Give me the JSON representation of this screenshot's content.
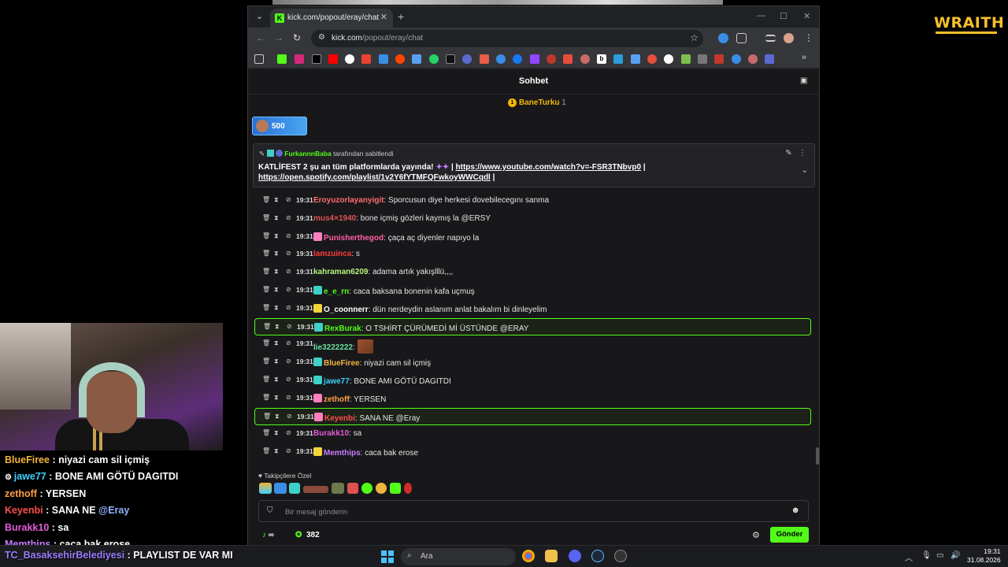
{
  "overlay": {
    "brand": "WRAITH",
    "chat": [
      {
        "user": "BlueFiree",
        "text": " : niyazi cam sil içmiş",
        "color": "#f0b53c",
        "badge": false
      },
      {
        "user": "jawe77",
        "text": " : BONE AMI GÖTÜ DAGITDI",
        "color": "#3fd0ff",
        "badge": true
      },
      {
        "user": "zethoff",
        "text": " : YERSEN",
        "color": "#ff9f43",
        "badge": false
      },
      {
        "user": "Keyenbi",
        "text": " : SANA NE ",
        "mention": "@Eray",
        "color": "#ff4d4d",
        "badge": false
      },
      {
        "user": "Burakk10",
        "text": " : sa",
        "color": "#e35bd9",
        "badge": false
      },
      {
        "user": "Memthips",
        "text": " : caca bak erose",
        "color": "#c87dff",
        "badge": false
      },
      {
        "user": "TC_BasaksehirBelediyesi",
        "text": " : PLAYLIST DE VAR MI",
        "color": "#9b7dff",
        "badge": false
      }
    ]
  },
  "browser": {
    "tab_title": "kick.com/popout/eray/chat",
    "url_domain": "kick.com",
    "url_path": "/popout/eray/chat"
  },
  "chat": {
    "title": "Sohbet",
    "gifter": "BaneTurku",
    "gifter_count": "1",
    "kicks_value": "500",
    "pinned_by_user": "FurkannnBaba",
    "pinned_by_suffix": " tarafından sabitlendi",
    "pinned_text": "KATLİFEST 2 şu an tüm platformlarda yayında! ",
    "pinned_link1": "https://www.youtube.com/watch?v=-FSR3TNbvp0",
    "pinned_link2": "https://open.spotify.com/playlist/1v2Y6fYTMFQFwkoyWWCqdl",
    "pinned_sep": " | ",
    "messages": [
      {
        "time": "19:31",
        "user": "Eroyuzorlayanyigit",
        "color": "#ff6b6b",
        "text": "Sporcusun diye herkesi dovebilecegını sanma",
        "badge": "",
        "hl": false
      },
      {
        "time": "19:31",
        "user": "mus4×1940",
        "color": "#e05252",
        "text": "bone içmiş gözleri kaymış la @ERSY",
        "badge": "",
        "hl": false
      },
      {
        "time": "19:31",
        "user": "Punisherthegod",
        "color": "#ff5fa2",
        "text": "çaça aç diyenler napıyo la",
        "badge": "3m",
        "badgeColor": "#ff7fbf",
        "hl": false
      },
      {
        "time": "19:31",
        "user": "Iamzuinca",
        "color": "#ff3b3b",
        "text": "s",
        "badge": "",
        "hl": false
      },
      {
        "time": "19:31",
        "user": "kahraman6209",
        "color": "#b7f37a",
        "text": "adama artık yakışlllü,,,,",
        "badge": "",
        "hl": false
      },
      {
        "time": "19:31",
        "user": "e_e_rn",
        "color": "#53fc18",
        "text": "caca baksana bonenin kafa uçmuş",
        "badge": "12",
        "badgeColor": "#3fd0c8",
        "hl": false
      },
      {
        "time": "19:31",
        "user": "O_coonnerr",
        "color": "#ffffff",
        "text": "dün nerdeydin aslanım anlat bakalım bi dinleyelim",
        "badge": "18",
        "badgeColor": "#f2d43a",
        "hl": false
      },
      {
        "time": "19:31",
        "user": "RexBurak",
        "color": "#53fc18",
        "text": "O TSHİRT ÇÜRÜMEDİ Mİ ÜSTÜNDE @ERAY",
        "badge": "36",
        "badgeColor": "#3fd0c8",
        "hl": true
      },
      {
        "time": "19:31",
        "user": "lie3222222",
        "color": "#6be0a0",
        "text": "",
        "badge": "",
        "hl": false,
        "emote": true
      },
      {
        "time": "19:31",
        "user": "BlueFiree",
        "color": "#f0b53c",
        "text": "niyazi cam sil içmiş",
        "badge": "36",
        "badgeColor": "#3fd0c8",
        "hl": false
      },
      {
        "time": "19:31",
        "user": "jawe77",
        "color": "#3fd0ff",
        "text": "BONE AMI GÖTÜ DAGITDI",
        "badge": "24",
        "badgeColor": "#3fd0c8",
        "hl": false
      },
      {
        "time": "19:31",
        "user": "zethoff",
        "color": "#ff9f43",
        "text": "YERSEN",
        "badge": "3m",
        "badgeColor": "#ff7fbf",
        "hl": false
      },
      {
        "time": "19:31",
        "user": "Keyenbi",
        "color": "#ff4d4d",
        "text": "SANA NE @Eray",
        "badge": "3m",
        "badgeColor": "#ff7fbf",
        "hl": true
      },
      {
        "time": "19:31",
        "user": "Burakk10",
        "color": "#e35bd9",
        "text": "sa",
        "badge": "",
        "hl": false
      },
      {
        "time": "19:31",
        "user": "Memthips",
        "color": "#c87dff",
        "text": "caca bak erose",
        "badge": "11",
        "badgeColor": "#f2d43a",
        "hl": false
      }
    ],
    "follower_label": "Takipçilere Özel",
    "input_placeholder": "Bir mesaj gönderin",
    "stat_infinity": "∞",
    "stat_count": "382",
    "send_label": "Gönder"
  },
  "taskbar": {
    "search_placeholder": "Ara",
    "time": "19:31",
    "date": "31.08.2026"
  }
}
